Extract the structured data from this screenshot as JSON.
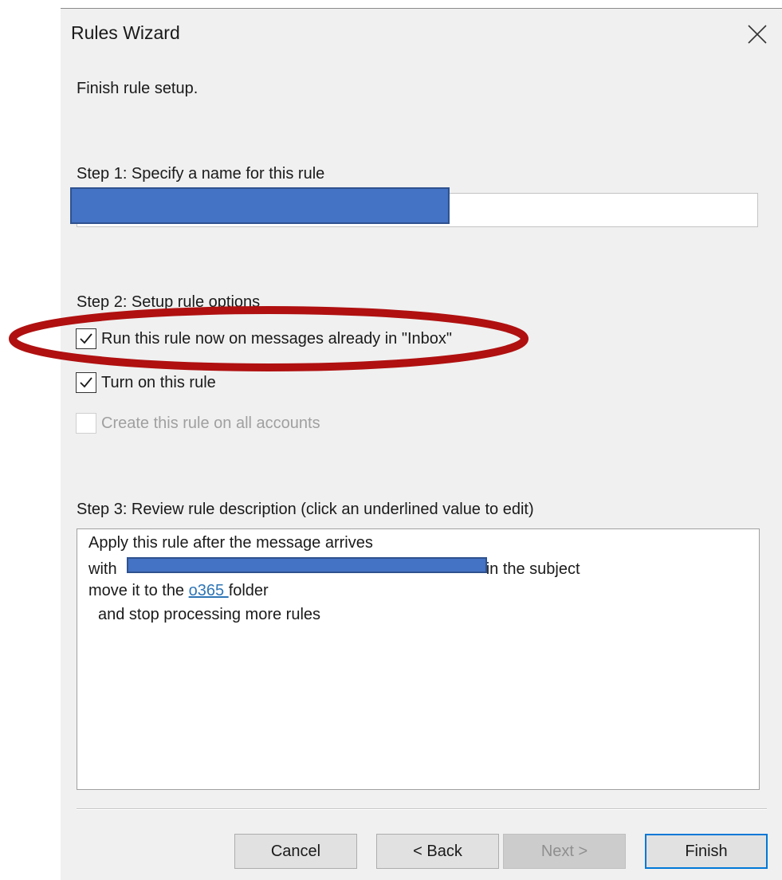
{
  "window": {
    "title": "Rules Wizard"
  },
  "intro_text": "Finish rule setup.",
  "step1": {
    "label": "Step 1: Specify a name for this rule",
    "rule_name_value": ""
  },
  "step2": {
    "label": "Step 2: Setup rule options",
    "options": [
      {
        "label": "Run this rule now on messages already in \"Inbox\"",
        "checked": true,
        "enabled": true
      },
      {
        "label": "Turn on this rule",
        "checked": true,
        "enabled": true
      },
      {
        "label": "Create this rule on all accounts",
        "checked": false,
        "enabled": false
      }
    ]
  },
  "step3": {
    "label": "Step 3: Review rule description (click an underlined value to edit)",
    "line1": "Apply this rule after the message arrives",
    "line2_prefix": "with",
    "line2_suffix": "in the subject",
    "line3_prefix": "move it to the",
    "line3_link": "o365 ",
    "line3_suffix": "folder",
    "line4": "and stop processing more rules"
  },
  "buttons": {
    "cancel": "Cancel",
    "back": "< Back",
    "next": "Next >",
    "finish": "Finish"
  },
  "annotation_color": "#b01010",
  "redaction_color": "#4472c4",
  "link_color": "#2e75b6"
}
